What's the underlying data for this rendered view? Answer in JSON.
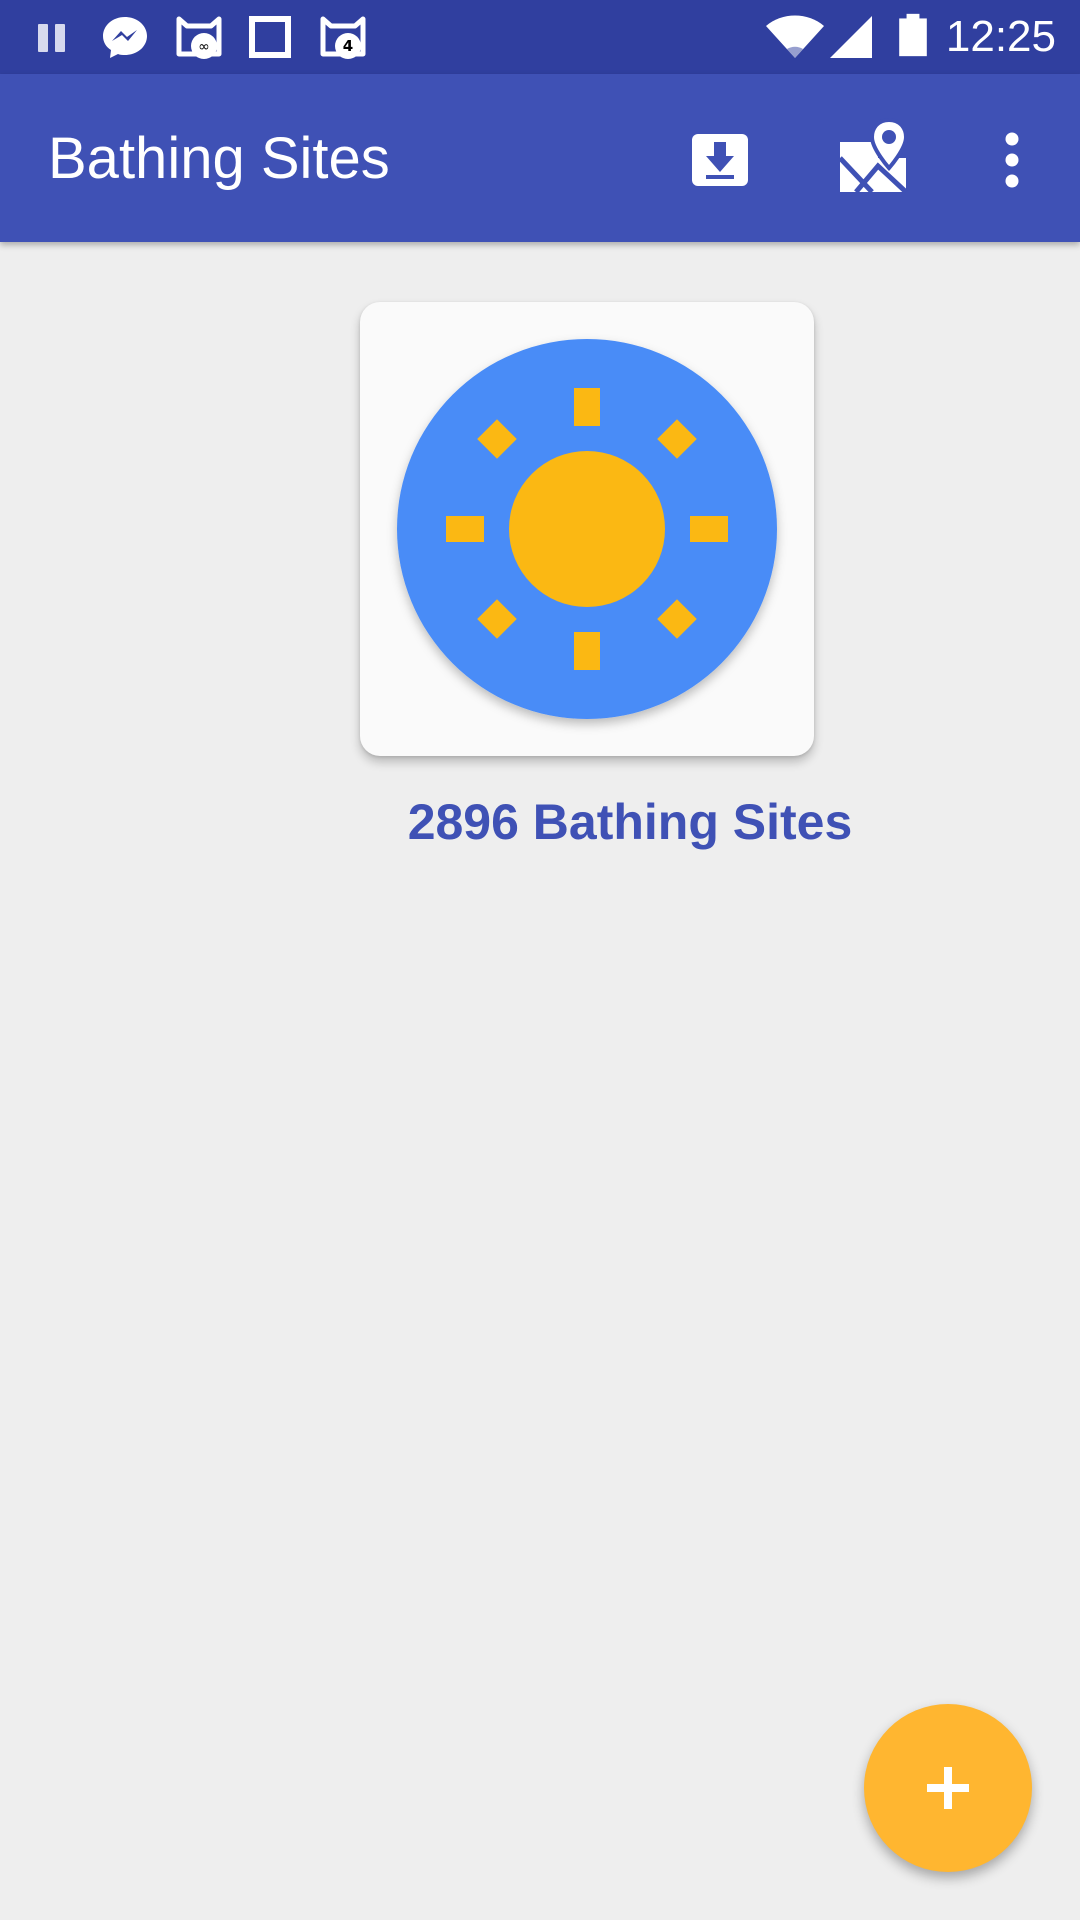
{
  "status_bar": {
    "time": "12:25",
    "notification_badge": "4",
    "icons": [
      "pause-icon",
      "messenger-icon",
      "cat-notification-icon",
      "square-icon",
      "cat-notification-4-icon",
      "wifi-icon",
      "cell-signal-icon",
      "battery-icon"
    ]
  },
  "app_bar": {
    "title": "Bathing Sites",
    "actions": [
      "download-icon",
      "map-pin-icon",
      "more-vert-icon"
    ]
  },
  "main": {
    "tile_icon": "sun-icon",
    "tile_label": "2896 Bathing Sites"
  },
  "fab": {
    "icon": "plus-icon"
  },
  "colors": {
    "status_bar": "#303f9f",
    "primary": "#3f51b5",
    "accent": "#ffb630",
    "background": "#eeeeee",
    "sun_blue": "#4a8cf7",
    "sun_yellow": "#fbb813"
  }
}
